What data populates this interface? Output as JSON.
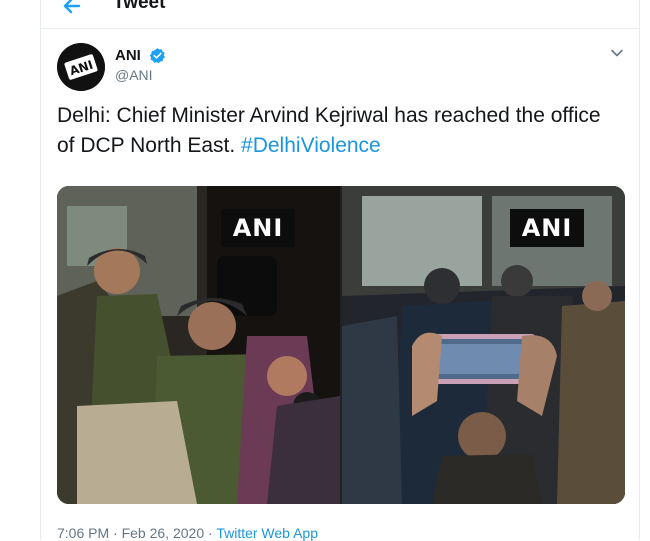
{
  "header": {
    "title": "Tweet",
    "back_icon": "arrow-left-icon"
  },
  "tweet": {
    "author": {
      "name": "ANI",
      "handle": "@ANI",
      "verified": true,
      "avatar_text": "ANI"
    },
    "text_main": "Delhi: Chief Minister Arvind Kejriwal has reached the office of DCP North East.",
    "hashtag": "#DelhiViolence",
    "media": [
      {
        "watermark": "ANI"
      },
      {
        "watermark": "ANI"
      }
    ],
    "time": "7:06 PM",
    "date": "Feb 26, 2020",
    "separator": "·",
    "source": "Twitter Web App"
  },
  "colors": {
    "accent": "#1b95e0",
    "verified": "#1da1f2",
    "text": "#14171a",
    "muted": "#657786"
  }
}
